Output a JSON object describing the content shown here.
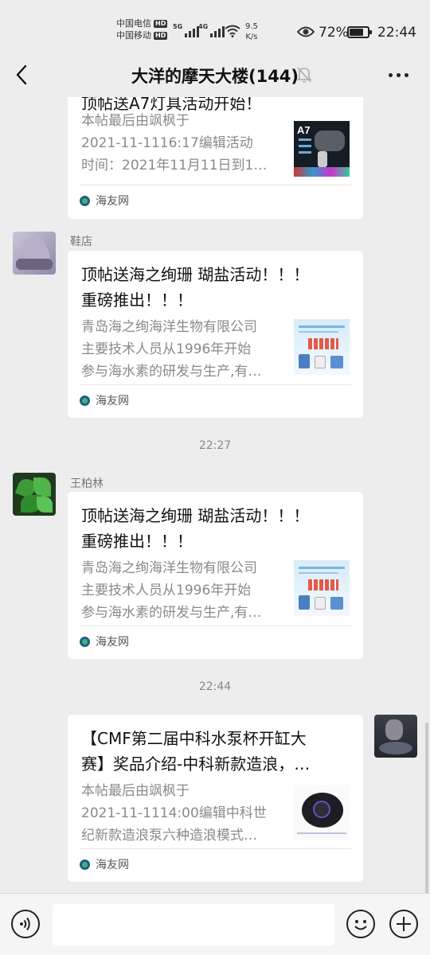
{
  "status_bar": {
    "carrier1": "中国电信",
    "carrier2": "中国移动",
    "hd": "HD",
    "net1": "5G",
    "net2": "4G",
    "speed_value": "9.5",
    "speed_unit": "K/s",
    "battery_percent": "72%",
    "battery_level": 0.72,
    "time": "22:44"
  },
  "header": {
    "title": "大洋的摩天大楼(144)",
    "muted_icon": "bell-off-icon",
    "back_icon": "chevron-left-icon",
    "more_icon": "more-dots-icon"
  },
  "messages": [
    {
      "title": "顶帖送A7灯具活动开始！",
      "desc": [
        "本帖最后由飒枫于",
        "2021-11-1116:17编辑活动",
        "时间：2021年11月11日到1…"
      ],
      "source": "海友网"
    },
    {
      "sender": "鞋店",
      "title_lines": [
        "顶帖送海之绚珊 瑚盐活动！！！",
        "重磅推出！！！"
      ],
      "desc": [
        "青岛海之绚海洋生物有限公司",
        "主要技术人员从1996年开始",
        "参与海水素的研发与生产,有…"
      ],
      "source": "海友网"
    },
    {
      "time": "22:27"
    },
    {
      "sender": "王柏林",
      "title_lines": [
        "顶帖送海之绚珊 瑚盐活动！！！",
        "重磅推出！！！"
      ],
      "desc": [
        "青岛海之绚海洋生物有限公司",
        "主要技术人员从1996年开始",
        "参与海水素的研发与生产,有…"
      ],
      "source": "海友网"
    },
    {
      "time": "22:44"
    },
    {
      "title_lines": [
        "【CMF第二届中科水泵杯开缸大",
        "赛】奖品介绍-中科新款造浪，…"
      ],
      "desc": [
        "本帖最后由飒枫于",
        "2021-11-1114:00编辑中科世",
        "纪新款造浪泵六种造浪模式…"
      ],
      "source": "海友网"
    }
  ],
  "thumb_a7_label": "A7",
  "input_bar": {
    "voice_icon": "voice-icon",
    "emoji_icon": "emoji-icon",
    "plus_icon": "plus-icon"
  }
}
